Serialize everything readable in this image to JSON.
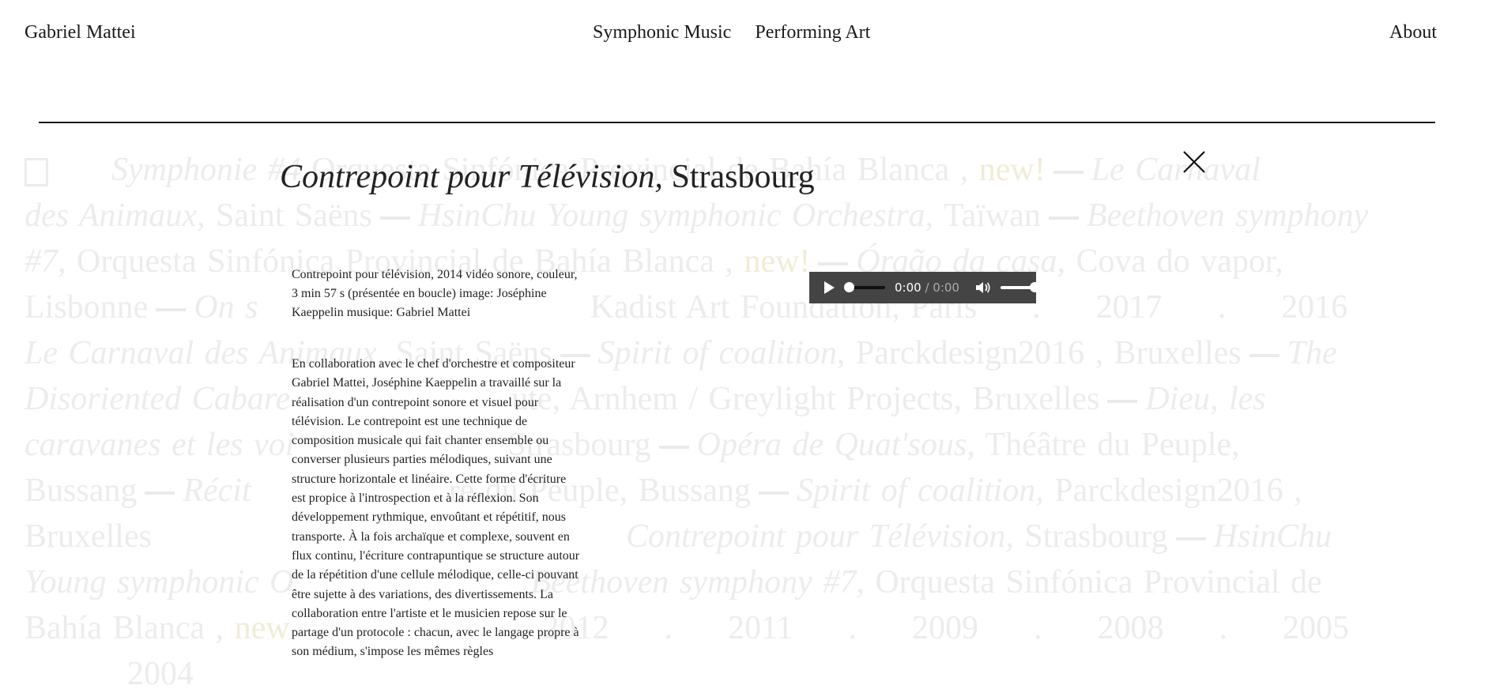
{
  "header": {
    "site_title": "Gabriel Mattei",
    "nav": [
      "Symphonic Music",
      "Performing Art"
    ],
    "about": "About"
  },
  "background_list": {
    "line1": [
      "Symphonie #4",
      "Orquesta Sinfónica Provincial de Bahía Blanca ,",
      "new!",
      "Le Carnaval"
    ],
    "line2": [
      "des Animaux,",
      "Saint Saëns",
      "HsinChu Young symphonic Orchestra,",
      "Taïwan",
      "Beethoven symphony"
    ],
    "line3": [
      "#7,",
      "Orquesta Sinfónica Provincial de Bahía Blanca ,",
      "new!",
      "Órgão da casa,",
      "Cova do vapor,"
    ],
    "line4": [
      "Lisbonne",
      "On s",
      "Kadist Art Foundation, Paris",
      "2017",
      "2016"
    ],
    "line5": [
      "Le Carnaval des Animaux,",
      "Saint Saëns",
      "Spirit of coalition,",
      "Parckdesign2016 , Bruxelles",
      "The"
    ],
    "line6": [
      "Disoriented Cabare",
      "ute, Arnhem / Greylight Projects, Bruxelles",
      "Dieu, les"
    ],
    "line7": [
      "caravanes et les voi",
      "Strasbourg",
      "Opéra de Quat'sous,",
      "Théâtre du Peuple,"
    ],
    "line8": [
      "Bussang",
      "Récit",
      "re du Peuple, Bussang",
      "Spirit of coalition,",
      "Parckdesign2016 ,"
    ],
    "line9": [
      "Bruxelles",
      "Contrepoint pour Télévision,",
      "Strasbourg",
      "HsinChu"
    ],
    "line10": [
      "Young symphonic O",
      "Beethoven symphony #7,",
      "Orquesta Sinfónica Provincial de"
    ],
    "line11": [
      "Bahía Blanca ,",
      "new",
      "2012",
      "2011",
      "2009",
      "2008",
      "2005"
    ],
    "line12": [
      "2004"
    ]
  },
  "modal": {
    "title_work": "Contrepoint pour Télévision,",
    "title_place": " Strasbourg",
    "info": "Contrepoint pour télévision, 2014 vidéo sonore, couleur, 3 min 57 s (présentée en boucle) image: Joséphine Kaeppelin musique: Gabriel Mattei",
    "description": "En collaboration avec le chef d'orchestre et compositeur Gabriel Mattei, Joséphine Kaeppelin a travaillé sur la réalisation d'un contrepoint sonore et visuel pour télévision. Le contrepoint est une technique de composition musicale qui fait chanter ensemble ou converser plusieurs parties mélodiques, suivant une structure horizontale et linéaire. Cette forme d'écriture est propice à l'introspection et à la réflexion. Son développement rythmique, envoûtant et répétitif, nous transporte. À la fois archaïque et complexe, souvent en flux continu, l'écriture contrapuntique se structure autour de la répétition d'une cellule mélodique, celle-ci pouvant être sujette à des variations, des divertissements. La collaboration entre l'artiste et le musicien repose sur le partage d'un protocole : chacun, avec le langage propre à son médium, s'impose les mêmes règles"
  },
  "audio": {
    "current_time": "0:00",
    "separator": " / ",
    "duration": "0:00",
    "progress_fraction": 0.0,
    "volume_fraction": 1.0
  },
  "colors": {
    "text": "#1a1a1a",
    "faded_text": "#ececec",
    "player_bg": "#444444"
  }
}
